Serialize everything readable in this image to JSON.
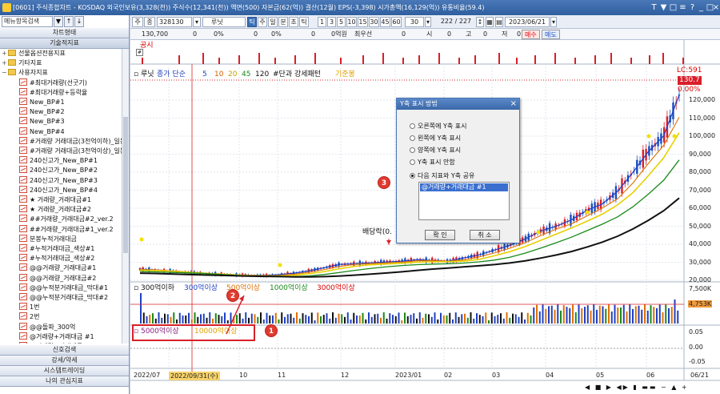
{
  "window": {
    "title": "[0601] 주식종합차트 - KOSDAQ 외국인보유(3,328(천)) 주식수(12,341(천)) 액면(500) 자본금(62(억)) 결산(12월) EPS(-3,398) 시가총액(16,129(억)) 유통비율(59.4)",
    "controls": [
      "?",
      "_",
      "□",
      "×"
    ],
    "extra_icons": [
      "T",
      "▼",
      "□",
      "≡"
    ]
  },
  "sidebar": {
    "search_placeholder": "메뉴항목검색",
    "search_btn1": "▼",
    "search_btn2": "↑",
    "search_btn3": "↓",
    "tabs_top": [
      "차트형태",
      "기술적지표"
    ],
    "tree": [
      {
        "label": "선물옵션전용지표",
        "kind": "folder",
        "indent": 0
      },
      {
        "label": "기타지표",
        "kind": "folder",
        "indent": 0
      },
      {
        "label": "사용자지표",
        "kind": "folder",
        "indent": 0
      },
      {
        "label": "#최대거래량(선굿기)",
        "kind": "item",
        "indent": 1
      },
      {
        "label": "#최대거래량+등락율",
        "kind": "item",
        "indent": 1
      },
      {
        "label": "New_BP#1",
        "kind": "item",
        "indent": 1
      },
      {
        "label": "New_BP#2",
        "kind": "item",
        "indent": 1
      },
      {
        "label": "New_BP#3",
        "kind": "item",
        "indent": 1
      },
      {
        "label": "New_BP#4",
        "kind": "item",
        "indent": 1
      },
      {
        "label": "#거래량 거래대금(3천억이하)_일봉",
        "kind": "item",
        "indent": 1
      },
      {
        "label": "#거래량 거래대금(3천억이상)_일봉",
        "kind": "item",
        "indent": 1
      },
      {
        "label": "240신고가_New_BP#1",
        "kind": "item",
        "indent": 1
      },
      {
        "label": "240신고가_New_BP#2",
        "kind": "item",
        "indent": 1
      },
      {
        "label": "240신고가_New_BP#3",
        "kind": "item",
        "indent": 1
      },
      {
        "label": "240신고가_New_BP#4",
        "kind": "item",
        "indent": 1
      },
      {
        "label": "★ 거래량_거래대금#1",
        "kind": "item",
        "indent": 1
      },
      {
        "label": "★ 거래량_거래대금#2",
        "kind": "item",
        "indent": 1
      },
      {
        "label": "##거래량_거래대금#2_ver.2",
        "kind": "item",
        "indent": 1
      },
      {
        "label": "##거래량_거래대금#1_ver.2",
        "kind": "item",
        "indent": 1
      },
      {
        "label": "분봉누적거래대금",
        "kind": "item",
        "indent": 1
      },
      {
        "label": "#누적거래대금_색상#1",
        "kind": "item",
        "indent": 1
      },
      {
        "label": "#누적거래대금_색상#2",
        "kind": "item",
        "indent": 1
      },
      {
        "label": "@@거래량_거래대금#1",
        "kind": "item",
        "indent": 1
      },
      {
        "label": "@@거래량_거래대금#2",
        "kind": "item",
        "indent": 1
      },
      {
        "label": "@@누적분거래대금_막대#1",
        "kind": "item",
        "indent": 1
      },
      {
        "label": "@@누적분거래대금_막대#2",
        "kind": "item",
        "indent": 1
      },
      {
        "label": "1번",
        "kind": "item",
        "indent": 1
      },
      {
        "label": "2번",
        "kind": "item",
        "indent": 1
      },
      {
        "label": "@@돌파_300억",
        "kind": "item",
        "indent": 1
      },
      {
        "label": "@거래량+거래대금 #1",
        "kind": "item",
        "indent": 1
      },
      {
        "label": "@거래량+거래대금 #2",
        "kind": "item",
        "indent": 1
      }
    ],
    "tabs_bottom": [
      "신호검색",
      "강세/약세",
      "시스템트레이딩",
      "나의 관심지표"
    ]
  },
  "toolbar": {
    "mode1": "주",
    "mode2": "종",
    "code": "328130",
    "name": "루닛",
    "period_buttons": [
      "틱",
      "주",
      "일",
      "분",
      "초",
      "틱"
    ],
    "intervals": [
      "1",
      "3",
      "5",
      "10",
      "15",
      "30",
      "45",
      "60"
    ],
    "interval_value": "30",
    "count": "222 / 227",
    "date": "2023/06/21",
    "row2": {
      "price": "130,700",
      "v1": "0",
      "p1": "0%",
      "v2": "0",
      "p2": "0%",
      "v3": "0",
      "vol": "0억원",
      "label_min": "최우선",
      "v4": "0",
      "label_si": "시",
      "v5": "0",
      "label_go": "고",
      "v6": "0",
      "label_jeo": "저",
      "v7": "0",
      "buy": "매수",
      "sell": "매도"
    }
  },
  "chart": {
    "gongsi": "공시",
    "legend_top": {
      "name": "루닛",
      "ma_label": "종가 단순",
      "ma_values": [
        "5",
        "10",
        "20",
        "45",
        "120"
      ],
      "pattern": "#단과 강세패턴",
      "ext": "기준봉"
    },
    "price_labels": {
      "lc": "LC:591",
      "price": "130.7",
      "pct": "0.00%"
    },
    "baedang": "배당락(0.",
    "vol_legend": [
      "300억이하",
      "300억이상",
      "500억이상",
      "1000억이상",
      "3000억이상"
    ],
    "vol_legend2": [
      "5000억이상",
      "10000억이상"
    ],
    "vol_axis": [
      "7,500K",
      "4,753K"
    ],
    "osc_axis": [
      "0.05",
      "0.00",
      "-0.05"
    ],
    "dates": [
      "2022/07",
      "2022/09/31(수)",
      "10",
      "11",
      "12",
      "2023/01",
      "02",
      "03",
      "04",
      "05",
      "06",
      "06/21"
    ],
    "y_axis": [
      "120,000",
      "110,000",
      "100,000",
      "90,000",
      "80,000",
      "70,000",
      "60,000",
      "50,000",
      "40,000",
      "30,000",
      "20,000"
    ]
  },
  "dialog": {
    "title": "Y축 표시 방법",
    "options": [
      "오른쪽에 Y축 표시",
      "왼쪽에 Y축 표시",
      "양쪽에 Y축 표시",
      "Y축 표시 안함",
      "다음 지표와 Y축 공유"
    ],
    "selected_index": 4,
    "list_item": "@거래량+거래대금 #1",
    "ok": "확 인",
    "cancel": "취 소"
  },
  "callouts": [
    "1",
    "2",
    "3"
  ],
  "chart_data": {
    "type": "line",
    "series": [
      {
        "name": "루닛",
        "values": [
          21000,
          20500,
          19800,
          19000,
          18500,
          18000,
          17500,
          17200,
          17000,
          17500,
          18500,
          20000,
          22000,
          24000,
          24500,
          25000,
          25500,
          26000,
          27000,
          26500,
          26000,
          28000,
          30000,
          33000,
          36000,
          40000,
          45000,
          48000,
          52000,
          58000,
          62000,
          70000,
          82000,
          95000,
          105000,
          130700
        ]
      }
    ],
    "ylim": [
      15000,
      135000
    ]
  }
}
